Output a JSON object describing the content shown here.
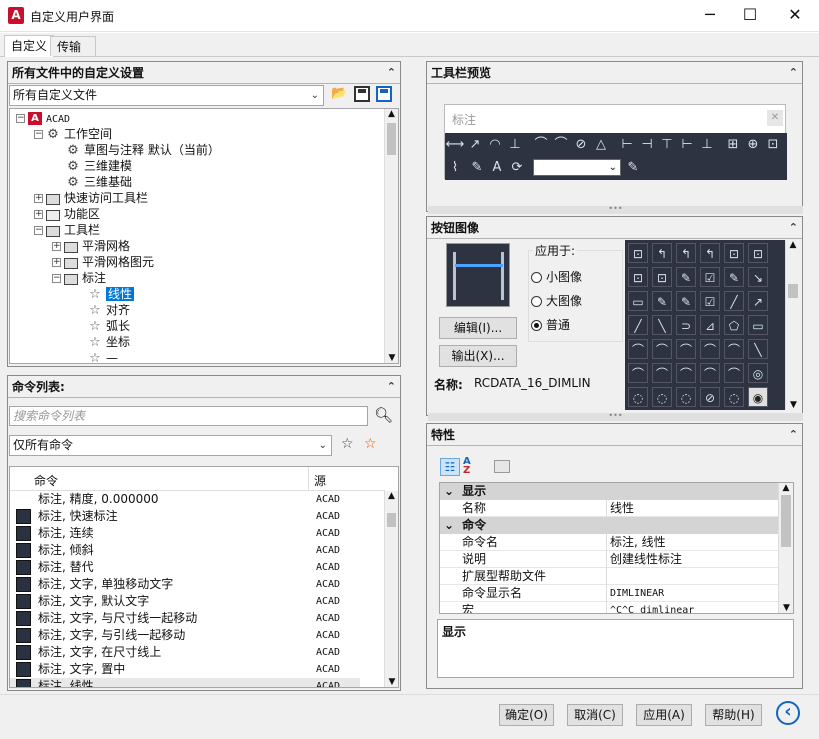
{
  "window": {
    "title": "自定义用户界面",
    "logo": "A",
    "minimize_icon": "─",
    "maximize_icon": "☐",
    "close_icon": "✕"
  },
  "tabs": [
    {
      "label": "自定义"
    },
    {
      "label": "传输"
    }
  ],
  "left_top": {
    "title": "所有文件中的自定义设置",
    "collapse_icon": "⌃",
    "filter_value": "所有自定义文件",
    "tree": [
      {
        "label": "ACAD"
      },
      {
        "label": "工作空间"
      },
      {
        "label": "草图与注释 默认（当前）"
      },
      {
        "label": "三维建模"
      },
      {
        "label": "三维基础"
      },
      {
        "label": "快速访问工具栏"
      },
      {
        "label": "功能区"
      },
      {
        "label": "工具栏"
      },
      {
        "label": "平滑网格"
      },
      {
        "label": "平滑网格图元"
      },
      {
        "label": "标注"
      },
      {
        "label": "线性"
      },
      {
        "label": "对齐"
      },
      {
        "label": "弧长"
      },
      {
        "label": "坐标"
      },
      {
        "label": "—"
      }
    ]
  },
  "cmd_list": {
    "title": "命令列表:",
    "search_placeholder": "搜索命令列表",
    "filter_value": "仅所有命令",
    "col_command": "命令",
    "col_source": "源",
    "rows": [
      {
        "name": "标注, 精度, 0.000000",
        "src": "ACAD"
      },
      {
        "name": "标注, 快速标注",
        "src": "ACAD"
      },
      {
        "name": "标注, 连续",
        "src": "ACAD"
      },
      {
        "name": "标注, 倾斜",
        "src": "ACAD"
      },
      {
        "name": "标注, 替代",
        "src": "ACAD"
      },
      {
        "name": "标注, 文字, 单独移动文字",
        "src": "ACAD"
      },
      {
        "name": "标注, 文字, 默认文字",
        "src": "ACAD"
      },
      {
        "name": "标注, 文字, 与尺寸线一起移动",
        "src": "ACAD"
      },
      {
        "name": "标注, 文字, 与引线一起移动",
        "src": "ACAD"
      },
      {
        "name": "标注, 文字, 在尺寸线上",
        "src": "ACAD"
      },
      {
        "name": "标注, 文字, 置中",
        "src": "ACAD"
      },
      {
        "name": "标注, 线性",
        "src": "ACAD"
      }
    ]
  },
  "toolbar_preview": {
    "title": "工具栏预览",
    "palette_title": "标注",
    "close_icon": "✕"
  },
  "button_image": {
    "title": "按钮图像",
    "apply_to": "应用于:",
    "radio_small": "小图像",
    "radio_large": "大图像",
    "radio_normal": "普通",
    "edit_button": "编辑(I)...",
    "export_button": "输出(X)...",
    "name_label": "名称:",
    "name_value": "RCDATA_16_DIMLIN"
  },
  "properties": {
    "title": "特性",
    "cat_display": "显示",
    "cat_command": "命令",
    "rows_display": [
      {
        "k": "名称",
        "v": "线性"
      }
    ],
    "rows_command": [
      {
        "k": "命令名",
        "v": "标注, 线性"
      },
      {
        "k": "说明",
        "v": "创建线性标注"
      },
      {
        "k": "扩展型帮助文件",
        "v": ""
      },
      {
        "k": "命令显示名",
        "v": "DIMLINEAR"
      },
      {
        "k": "宏",
        "v": "^C^C_dimlinear"
      }
    ],
    "desc_title": "显示"
  },
  "footer": {
    "ok": "确定(O)",
    "cancel": "取消(C)",
    "apply": "应用(A)",
    "help": "帮助(H)",
    "back_icon": "‹"
  },
  "colors": {
    "accent": "#0078d7",
    "logo": "#c8102e",
    "palette_bg": "#2d3340"
  }
}
